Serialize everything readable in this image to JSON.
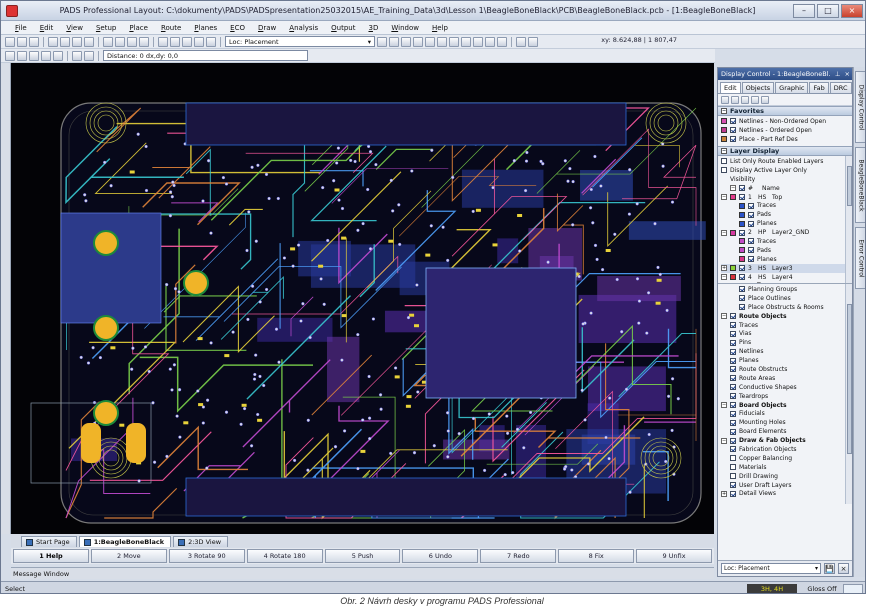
{
  "window": {
    "title": "PADS Professional Layout: C:\\dokumenty\\PADS\\PADSpresentation25032015\\AE_Training_Data\\3d\\Lesson 1\\BeagleBoneBlack\\PCB\\BeagleBoneBlack.pcb - [1:BeagleBoneBlack]",
    "minimize": "–",
    "maximize": "□",
    "close": "×"
  },
  "menu": [
    "File",
    "Edit",
    "View",
    "Setup",
    "Place",
    "Route",
    "Planes",
    "ECO",
    "Draw",
    "Analysis",
    "Output",
    "3D",
    "Window",
    "Help"
  ],
  "readout": {
    "coords": "xy: 8.624,88 | 1 807,47",
    "delta": "dx,dy: 6.291,81 | -2 901,73"
  },
  "toolbar": {
    "mode_select": "Loc: Placement",
    "distance": "Distance: 0 dx,dy: 0,0"
  },
  "document_tabs": [
    {
      "label": "Start Page",
      "active": false
    },
    {
      "label": "1:BeagleBoneBlack",
      "active": true
    },
    {
      "label": "2:3D View",
      "active": false
    }
  ],
  "fkeys": [
    "1 Help",
    "2 Move",
    "3 Rotate 90",
    "4 Rotate 180",
    "5 Push",
    "6 Undo",
    "7 Redo",
    "8 Fix",
    "9 Unfix"
  ],
  "message_window": "Message Window",
  "status": {
    "left": "Select",
    "layer": "3H, 4H",
    "gloss": "Gloss Off"
  },
  "panel": {
    "title": "Display Control - 1:BeagleBoneBl...",
    "tabs": [
      "Edit",
      "Objects",
      "Graphic",
      "Fab",
      "DRC",
      "3D"
    ],
    "favorites_header": "Favorites",
    "favorites": [
      {
        "label": "Netlines - Non-Ordered Open",
        "color": "#d64fb0"
      },
      {
        "label": "Netlines - Ordered Open",
        "color": "#c03c8f"
      },
      {
        "label": "Place - Part Ref Des",
        "color": "#c8843c"
      }
    ],
    "layer_header": "Layer Display",
    "layer_opts": [
      "List Only Route Enabled Layers",
      "Display Active Layer Only"
    ],
    "visibility_label": "Visibility",
    "col_number": "#",
    "col_name": "Name",
    "layers": [
      {
        "num": "1",
        "tag": "HS",
        "name": "Top",
        "color": "#e23b8c",
        "children": [
          {
            "label": "Traces",
            "color": "#2b53c9"
          },
          {
            "label": "Pads",
            "color": "#2b53c9"
          },
          {
            "label": "Planes",
            "color": "#2b53c9"
          }
        ]
      },
      {
        "num": "2",
        "tag": "HP",
        "name": "Layer2_GND",
        "color": "#d63aa0",
        "children": [
          {
            "label": "Traces",
            "color": "#c14cc6"
          },
          {
            "label": "Pads",
            "color": "#c14cc6"
          },
          {
            "label": "Planes",
            "color": "#d8358b"
          }
        ]
      },
      {
        "num": "3",
        "tag": "HS",
        "name": "Layer3",
        "color": "#8ad23a",
        "children": []
      },
      {
        "num": "4",
        "tag": "HS",
        "name": "Layer4",
        "color": "#d8303a",
        "children": [
          {
            "label": "Traces",
            "color": "#2b53c9"
          }
        ]
      }
    ],
    "misc_objects": [
      "Planning Groups",
      "Place Outlines",
      "Place Obstructs & Rooms"
    ],
    "route_header": "Route Objects",
    "route_objects": [
      "Traces",
      "Vias",
      "Pins",
      "Netlines",
      "Planes",
      "Route Obstructs",
      "Route Areas",
      "Conductive Shapes",
      "Teardrops"
    ],
    "board_header": "Board Objects",
    "board_objects": [
      "Fiducials",
      "Mounting Holes",
      "Board Elements"
    ],
    "drawfab_header": "Draw & Fab Objects",
    "drawfab_objects": [
      "Fabrication Objects",
      "Copper Balancing",
      "Materials",
      "Drill Drawing",
      "User Draft Layers"
    ],
    "detail_views": "Detail Views",
    "scheme_select": "Loc: Placement",
    "save": "💾",
    "close": "×"
  },
  "side_tabs": [
    "Display Control",
    "BeagleBoneBlack",
    "Error Control"
  ],
  "caption": "Obr. 2  Návrh desky v programu PADS Professional"
}
